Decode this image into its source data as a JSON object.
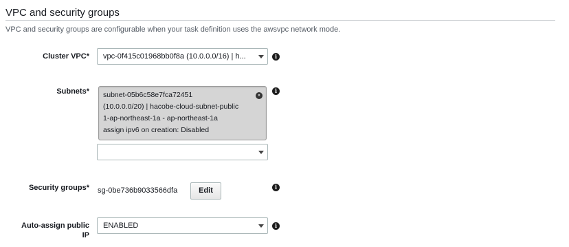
{
  "section": {
    "title": "VPC and security groups",
    "description": "VPC and security groups are configurable when your task definition uses the awsvpc network mode."
  },
  "cluster_vpc": {
    "label": "Cluster VPC*",
    "value": "vpc-0f415c01968bb0f8a (10.0.0.0/16) | h..."
  },
  "subnets": {
    "label": "Subnets*",
    "selected_lines": [
      "subnet-05b6c58e7fca72451",
      "(10.0.0.0/20) | hacobe-cloud-subnet-public",
      "1-ap-northeast-1a - ap-northeast-1a",
      "assign ipv6 on creation: Disabled"
    ],
    "remove_icon": "close-circle-icon",
    "dropdown_value": ""
  },
  "security_groups": {
    "label": "Security groups*",
    "value": "sg-0be736b9033566dfa",
    "edit_label": "Edit"
  },
  "auto_assign_ip": {
    "label_line1": "Auto-assign public",
    "label_line2": "IP",
    "value": "ENABLED"
  },
  "icons": {
    "info": "info-icon",
    "info_glyph": "i",
    "dropdown": "caret-down-icon",
    "remove_glyph": "×"
  }
}
